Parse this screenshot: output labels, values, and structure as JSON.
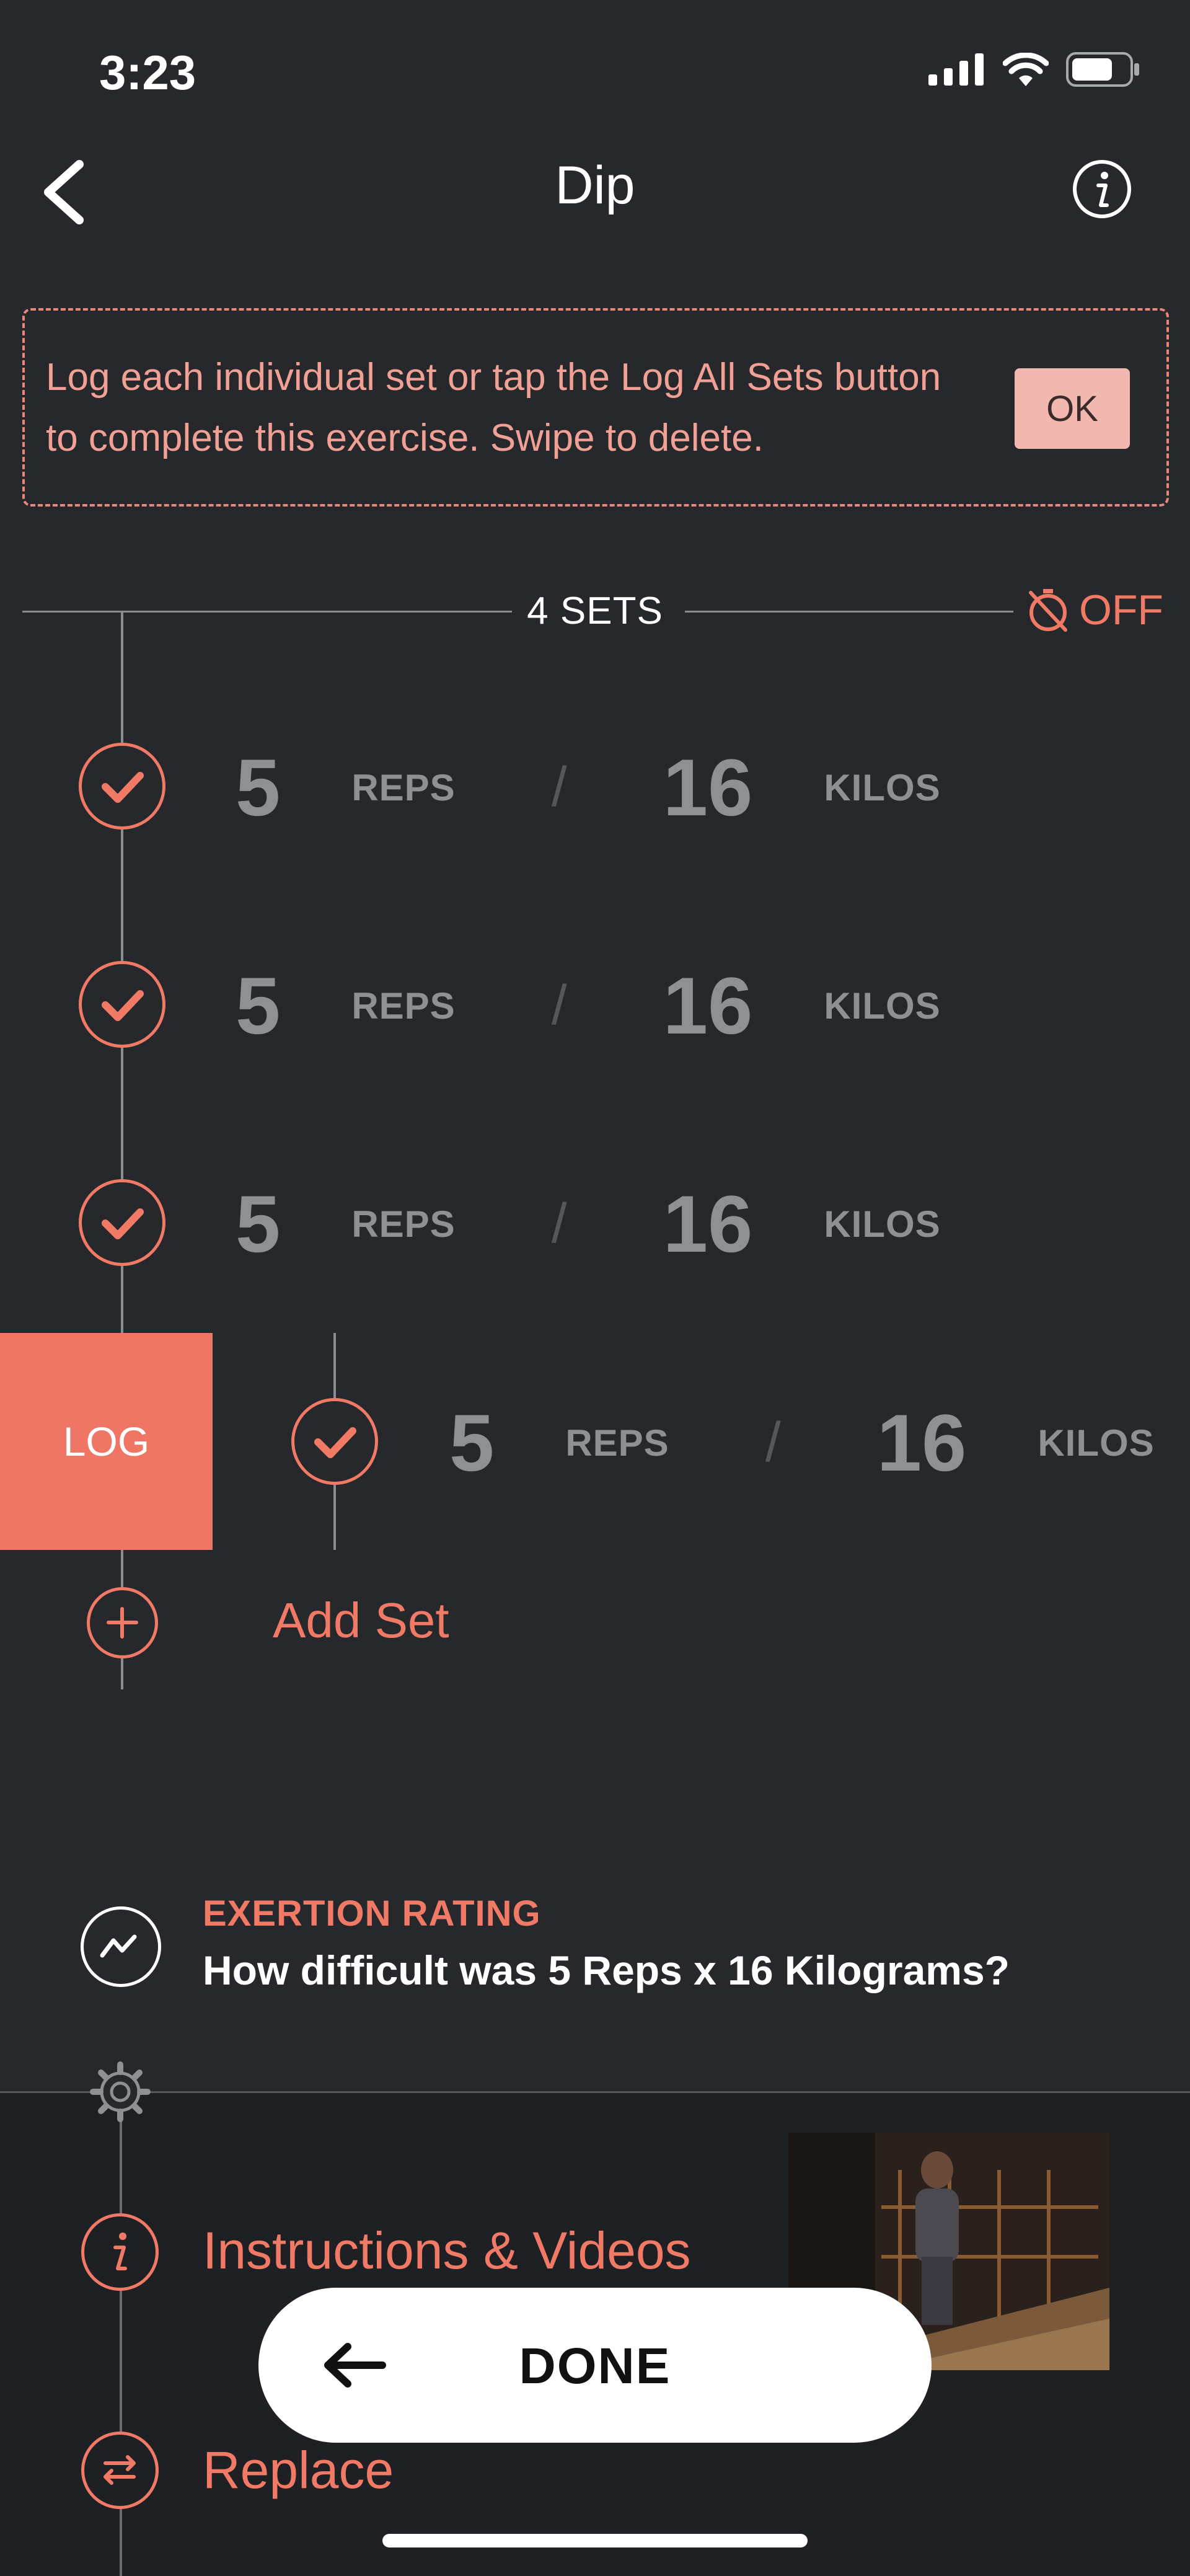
{
  "status_bar": {
    "time": "3:23"
  },
  "header": {
    "title": "Dip"
  },
  "tip": {
    "text": "Log each individual set or tap the Log All Sets button to complete this exercise. Swipe to delete.",
    "ok_label": "OK"
  },
  "sets_header": {
    "label": "4 SETS",
    "timer_label": "OFF"
  },
  "sets": [
    {
      "reps": "5",
      "reps_unit": "REPS",
      "separator": "/",
      "weight": "16",
      "weight_unit": "KILOS"
    },
    {
      "reps": "5",
      "reps_unit": "REPS",
      "separator": "/",
      "weight": "16",
      "weight_unit": "KILOS"
    },
    {
      "reps": "5",
      "reps_unit": "REPS",
      "separator": "/",
      "weight": "16",
      "weight_unit": "KILOS"
    },
    {
      "reps": "5",
      "reps_unit": "REPS",
      "separator": "/",
      "weight": "16",
      "weight_unit": "KILOS"
    }
  ],
  "log_button": {
    "label": "LOG"
  },
  "add_set": {
    "label": "Add Set"
  },
  "exertion": {
    "title": "EXERTION RATING",
    "question": "How difficult was 5 Reps x 16 Kilograms?"
  },
  "menu": {
    "instructions_label": "Instructions & Videos",
    "replace_label": "Replace"
  },
  "done_button": {
    "label": "DONE"
  },
  "colors": {
    "accent": "#ef7664",
    "background": "#26282c",
    "muted": "#8e9093"
  }
}
